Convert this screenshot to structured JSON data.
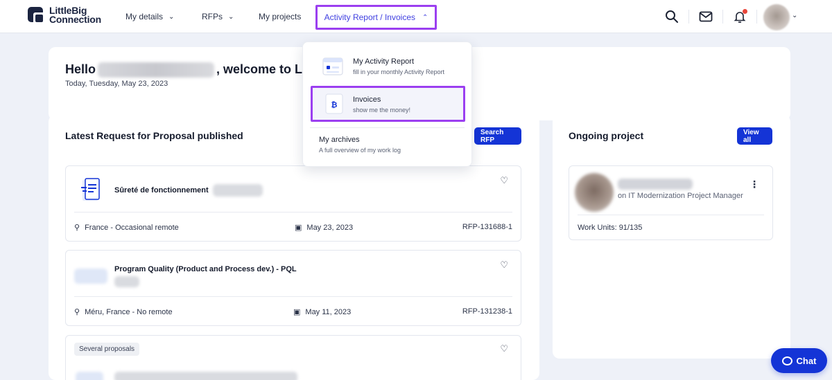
{
  "header": {
    "logo_line1": "LittleBig",
    "logo_line2": "Connection",
    "nav": {
      "my_details": "My details",
      "rfps": "RFPs",
      "my_projects": "My projects",
      "activity_invoices": "Activity Report / Invoices"
    },
    "icons": [
      "search-icon",
      "mail-icon",
      "bell-icon",
      "avatar"
    ]
  },
  "welcome": {
    "hello_prefix": "Hello",
    "hello_suffix": ", welcome to Li",
    "date": "Today, Tuesday, May 23, 2023"
  },
  "rfp": {
    "title": "Latest Request for Proposal published",
    "search_button": "Search RFP",
    "items": [
      {
        "name": "Sûreté de fonctionnement",
        "location": "France - Occasional remote",
        "date": "May 23, 2023",
        "ref": "RFP-131688-1"
      },
      {
        "name": "Program Quality (Product and Process dev.) - PQL",
        "location": "Méru, France - No remote",
        "date": "May 11, 2023",
        "ref": "RFP-131238-1"
      },
      {
        "badge": "Several proposals"
      }
    ]
  },
  "ongoing": {
    "title": "Ongoing project",
    "view_all": "View all",
    "project": {
      "role": "on IT Modernization Project Manager",
      "work_units": "Work Units: 91/135"
    }
  },
  "dropdown": {
    "activity_title": "My Activity Report",
    "activity_sub": "fill in your monthly Activity Report",
    "invoices_title": "Invoices",
    "invoices_sub": "show me the money!",
    "archives_title": "My archives",
    "archives_sub": "A full overview of my work log"
  },
  "chat": {
    "label": "Chat"
  },
  "colors": {
    "accent": "#1434d6",
    "highlight": "#9b3ff0",
    "nav_active": "#3f3fe0",
    "notification": "#e8463a"
  }
}
